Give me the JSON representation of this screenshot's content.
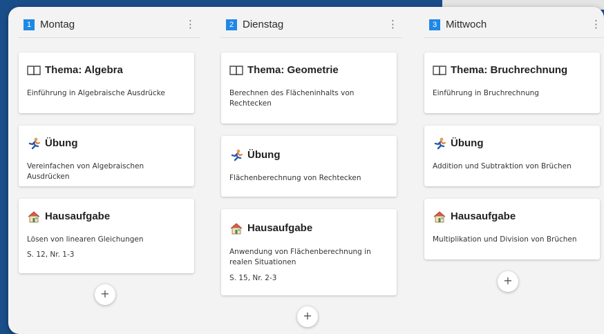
{
  "columns": [
    {
      "num": "1",
      "name": "Montag",
      "cards": [
        {
          "icon": "book-icon",
          "title": "Thema: Algebra",
          "desc": "Einführung in Algebraische Ausdrücke",
          "ref": ""
        },
        {
          "icon": "runner-icon",
          "title": "Übung",
          "desc": "Vereinfachen von Algebraischen Ausdrücken",
          "ref": ""
        },
        {
          "icon": "house-icon",
          "title": "Hausaufgabe",
          "desc": "Lösen von linearen Gleichungen",
          "ref": "S. 12, Nr. 1-3"
        }
      ],
      "add_label": "+"
    },
    {
      "num": "2",
      "name": "Dienstag",
      "cards": [
        {
          "icon": "book-icon",
          "title": "Thema: Geometrie",
          "desc": "Berechnen des Flächeninhalts von Rechtecken",
          "ref": ""
        },
        {
          "icon": "runner-icon",
          "title": "Übung",
          "desc": "Flächenberechnung von Rechtecken",
          "ref": ""
        },
        {
          "icon": "house-icon",
          "title": "Hausaufgabe",
          "desc": "Anwendung von Flächenberechnung in realen Situationen",
          "ref": "S. 15, Nr. 2-3"
        }
      ],
      "add_label": "+"
    },
    {
      "num": "3",
      "name": "Mittwoch",
      "cards": [
        {
          "icon": "book-icon",
          "title": "Thema: Bruchrechnung",
          "desc": "Einführung in Bruchrechnung",
          "ref": ""
        },
        {
          "icon": "runner-icon",
          "title": "Übung",
          "desc": "Addition und Subtraktion von Brüchen",
          "ref": ""
        },
        {
          "icon": "house-icon",
          "title": "Hausaufgabe",
          "desc": "Multiplikation und Division von Brüchen",
          "ref": ""
        }
      ],
      "add_label": "+"
    }
  ],
  "menu_glyph": "⋮",
  "colors": {
    "accent": "#1e88e5",
    "background": "#1a4e8a",
    "board": "#f3f3f3"
  }
}
